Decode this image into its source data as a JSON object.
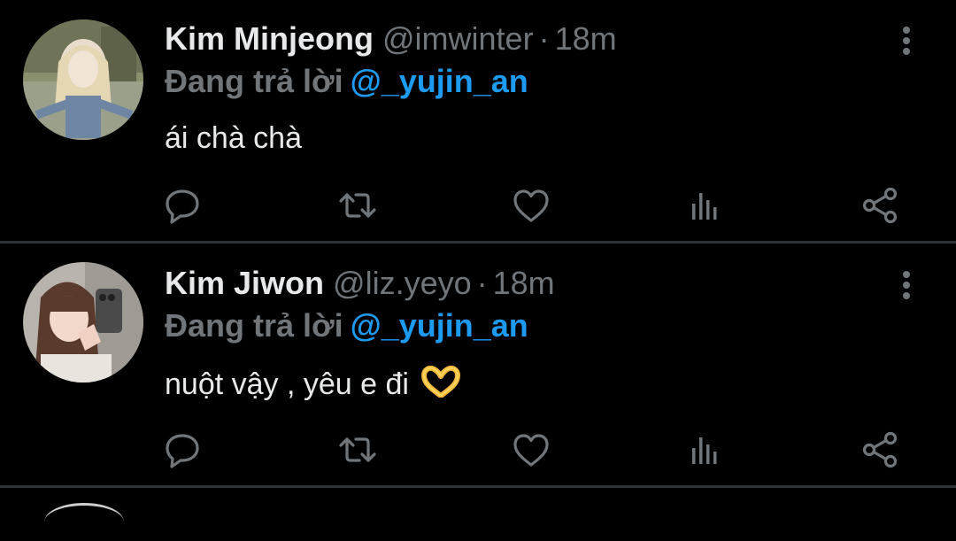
{
  "colors": {
    "background": "#000000",
    "primary_text": "#e7e9ea",
    "secondary_text": "#71767b",
    "accent": "#1d9bf0",
    "divider": "#2f3336"
  },
  "tweets": [
    {
      "author_name": "Kim Minjeong",
      "handle": "@imwinter",
      "separator": "·",
      "time": "18m",
      "reply_prefix": "Đang trả lời",
      "reply_to": "@_yujin_an",
      "text": "ái chà chà",
      "avatar_icon": "user-avatar",
      "more_icon": "more-vertical-icon"
    },
    {
      "author_name": "Kim Jiwon",
      "handle": "@liz.yeyo",
      "separator": "·",
      "time": "18m",
      "reply_prefix": "Đang trả lời",
      "reply_to": "@_yujin_an",
      "text": "nuột vậy , yêu e đi",
      "text_emoji": "heart-hands-emoji",
      "avatar_icon": "user-avatar",
      "more_icon": "more-vertical-icon"
    }
  ],
  "action_icons": [
    "reply-icon",
    "retweet-icon",
    "like-icon",
    "views-icon",
    "share-icon"
  ]
}
